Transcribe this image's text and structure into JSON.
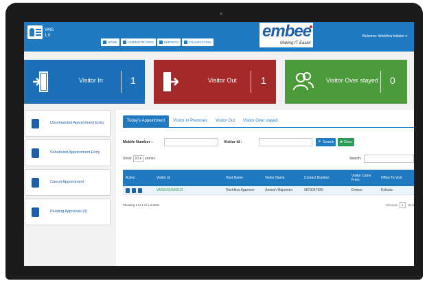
{
  "app": {
    "title_line1": "VMS",
    "title_line2": "1.0"
  },
  "nav": [
    {
      "label": "HOME"
    },
    {
      "label": "ADMINISTRATION"
    },
    {
      "label": "REPORTS"
    },
    {
      "label": "TRANSACTION"
    }
  ],
  "brand": {
    "name": "embee",
    "tagline": "Making IT Easier"
  },
  "user": {
    "welcome": "Welcome: Workflow Initiator ▾"
  },
  "stats": {
    "in": {
      "label": "Visitor In",
      "count": "1"
    },
    "out": {
      "label": "Visitor Out",
      "count": "1"
    },
    "over": {
      "label": "Visitor Over stayed",
      "count": "0"
    }
  },
  "menu": [
    {
      "label": "Unscheduled Appointment Entry"
    },
    {
      "label": "Scheduled Appointment Entry"
    },
    {
      "label": "Cancel Appointment"
    },
    {
      "label": "Pending Approvals (0)"
    }
  ],
  "tabs": [
    {
      "label": "Today's Appointment"
    },
    {
      "label": "Visitor In Premises"
    },
    {
      "label": "Visitor Out"
    },
    {
      "label": "Visitor Over stayed"
    }
  ],
  "filters": {
    "mobile_label": "Mobile Number :",
    "visitor_id_label": "Visitor Id :",
    "search_button": "Search",
    "clear_button": "Clear",
    "show_prefix": "Show",
    "show_value": "10 ▾",
    "show_suffix": "entries",
    "search_label": "Search:"
  },
  "table": {
    "headers": [
      "Action",
      "Visitor Id",
      "Host Name",
      "Visitor Name",
      "Contact Number",
      "Visitor Came From",
      "Office To Visit"
    ],
    "rows": [
      [
        "",
        "VMS/VIS/000013",
        "Workflow Approver",
        "Amtesh Majumder",
        "9873047689",
        "Embee",
        "Kolkata"
      ]
    ],
    "info": "Showing 1 to 1 of 1 entries",
    "previous": "Previous",
    "page": "1",
    "next": "Next"
  },
  "colors": {
    "primary": "#1f7ac2",
    "visitor_in": "#1d70b8",
    "visitor_out": "#a42a2a",
    "visitor_over": "#4c9b3a"
  }
}
